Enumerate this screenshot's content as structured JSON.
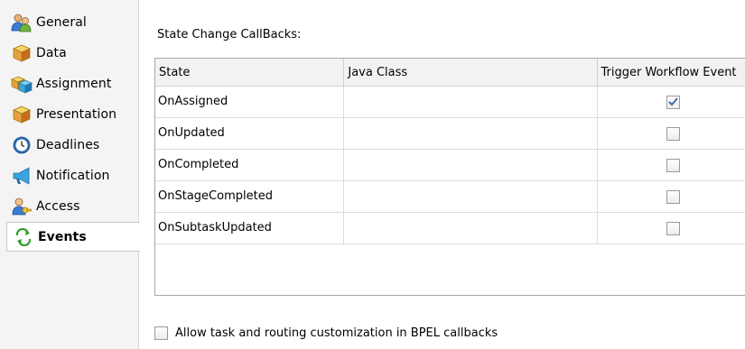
{
  "sidebar": {
    "items": [
      {
        "label": "General",
        "icon": "people-icon"
      },
      {
        "label": "Data",
        "icon": "data-cube-icon"
      },
      {
        "label": "Assignment",
        "icon": "assignment-cubes-icon"
      },
      {
        "label": "Presentation",
        "icon": "presentation-cube-icon"
      },
      {
        "label": "Deadlines",
        "icon": "clock-icon"
      },
      {
        "label": "Notification",
        "icon": "megaphone-icon"
      },
      {
        "label": "Access",
        "icon": "user-key-icon"
      },
      {
        "label": "Events",
        "icon": "green-arrows-icon",
        "selected": true
      }
    ]
  },
  "main": {
    "title": "State Change CallBacks:",
    "table": {
      "columns": [
        "State",
        "Java Class",
        "Trigger Workflow Event"
      ],
      "rows": [
        {
          "state": "OnAssigned",
          "java_class": "",
          "trigger": true
        },
        {
          "state": "OnUpdated",
          "java_class": "",
          "trigger": false
        },
        {
          "state": "OnCompleted",
          "java_class": "",
          "trigger": false
        },
        {
          "state": "OnStageCompleted",
          "java_class": "",
          "trigger": false
        },
        {
          "state": "OnSubtaskUpdated",
          "java_class": "",
          "trigger": false
        }
      ]
    },
    "bpel_option": {
      "label": "Allow task and routing customization in BPEL callbacks",
      "checked": false
    }
  },
  "colors": {
    "checkmark": "#3a6ea5",
    "selected_bg": "#ffffff",
    "sidebar_bg": "#f4f4f4"
  }
}
